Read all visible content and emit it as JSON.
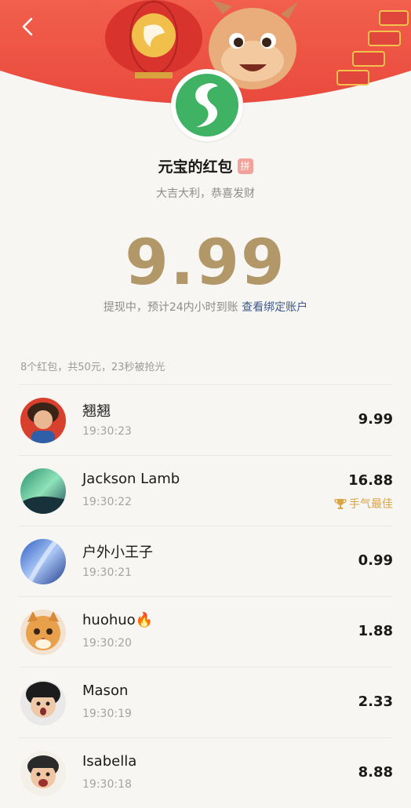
{
  "header": {
    "title": "元宝的红包",
    "badge": "拼",
    "subtitle": "大吉大利，恭喜发财"
  },
  "amount": "9.99",
  "status": {
    "text": "提现中，预计24内小时到账",
    "link": "查看绑定账户"
  },
  "summary": "8个红包，共50元，23秒被抢光",
  "best_label": "手气最佳",
  "records": [
    {
      "name": "翘翘",
      "time": "19:30:23",
      "amount": "9.99",
      "best": false
    },
    {
      "name": "Jackson Lamb",
      "time": "19:30:22",
      "amount": "16.88",
      "best": true
    },
    {
      "name": "户外小王子",
      "time": "19:30:21",
      "amount": "0.99",
      "best": false
    },
    {
      "name": "huohuo🔥",
      "time": "19:30:20",
      "amount": "1.88",
      "best": false
    },
    {
      "name": "Mason",
      "time": "19:30:19",
      "amount": "2.33",
      "best": false
    },
    {
      "name": "Isabella",
      "time": "19:30:18",
      "amount": "8.88",
      "best": false
    }
  ],
  "colors": {
    "banner": "#ee5a4a",
    "amount": "#b29869",
    "link": "#3d5a8a",
    "best": "#d9a441"
  },
  "icons": {
    "back": "chevron-left-icon",
    "logo": "yuanbao-logo-icon",
    "best": "trophy-icon"
  }
}
